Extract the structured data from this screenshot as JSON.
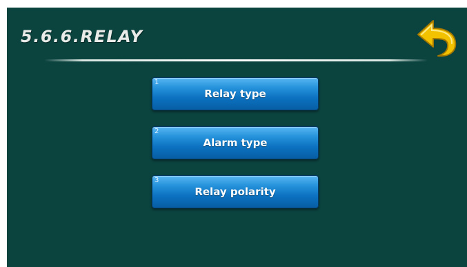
{
  "header": {
    "title": "5.6.6.RELAY"
  },
  "back_button": {
    "icon": "back-arrow-icon",
    "color": "#f2c200"
  },
  "menu": {
    "items": [
      {
        "number": "1",
        "label": "Relay type"
      },
      {
        "number": "2",
        "label": "Alarm type"
      },
      {
        "number": "3",
        "label": "Relay polarity"
      }
    ]
  },
  "colors": {
    "background": "#0b433f",
    "button": "#0c72c1",
    "title_text": "#e8ebe8"
  }
}
